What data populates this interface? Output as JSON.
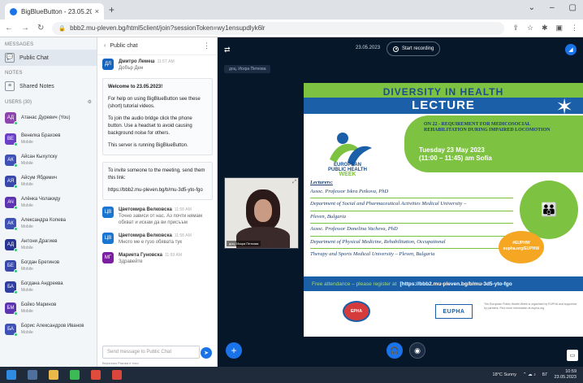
{
  "browser": {
    "tab_title": "BigBlueButton - 23.05.2023",
    "tab_close": "×",
    "new_tab": "+",
    "url": "bbb2.mu-pleven.bg/html5client/join?sessionToken=wy1ensupdlyk6lr",
    "window_controls": [
      "⌄",
      "–",
      "▢"
    ]
  },
  "sidebar": {
    "messages_label": "MESSAGES",
    "public_chat": "Public Chat",
    "notes_label": "NOTES",
    "shared_notes": "Shared Notes",
    "users_label": "USERS (30)",
    "users": [
      {
        "initials": "АД",
        "name": "Атанас Дуревич (You)",
        "sub": "",
        "color": "#8e44ad"
      },
      {
        "initials": "ВЕ",
        "name": "Венелка Брахоев",
        "sub": "Mobile",
        "color": "#6c3fc7"
      },
      {
        "initials": "АК",
        "name": "Айсан Кыхулску",
        "sub": "Mobile",
        "color": "#3f51b5"
      },
      {
        "initials": "АЯ",
        "name": "Айсум Ябдемич",
        "sub": "Mobile",
        "color": "#3949ab"
      },
      {
        "initials": "АЧ",
        "name": "Алёнка Чолакиду",
        "sub": "Mobile",
        "color": "#5e35b1"
      },
      {
        "initials": "АК",
        "name": "Александра Копева",
        "sub": "Mobile",
        "color": "#3f51b5"
      },
      {
        "initials": "АД",
        "name": "Антони Драгиев",
        "sub": "Mobile",
        "color": "#283593"
      },
      {
        "initials": "БЕ",
        "name": "Богдан Брегинов",
        "sub": "Mobile",
        "color": "#3949ab"
      },
      {
        "initials": "БА",
        "name": "Богдана Андреева",
        "sub": "Mobile",
        "color": "#303f9f"
      },
      {
        "initials": "БМ",
        "name": "Бойко Маринов",
        "sub": "Mobile",
        "color": "#5e35b1"
      },
      {
        "initials": "БА",
        "name": "Борис Александров Иванов",
        "sub": "Mobile",
        "color": "#3f51b5"
      }
    ]
  },
  "chat": {
    "back_label": "Public chat",
    "menu_icon": "⋮",
    "messages": [
      {
        "initials": "ДЛ",
        "name": "Дмитро Лемеш",
        "time": "11:57 AM",
        "text": "Добър Ден",
        "color": "#1565c0"
      }
    ],
    "welcome": "Welcome to 23.05.2023!",
    "help_text": "For help on using BigBlueButton see these (short) tutorial videos.",
    "audio_text": "To join the audio bridge click the phone button. Use a headset to avoid causing background noise for others.",
    "server_text": "This server is running BigBlueButton.",
    "invite_text": "To invite someone to the meeting, send them this link:",
    "invite_link": "https://bbb2.mu-pleven.bg/b/mu-3d5-yto-fgo",
    "later_messages": [
      {
        "initials": "ЦВ",
        "name": "Цветомира Велковска",
        "time": "11:58 AM",
        "text": "Точно зависи от нас. Аз почти нямам обхват и искам да ви присъъм",
        "color": "#1976d2"
      },
      {
        "initials": "ЦВ",
        "name": "Цветомира Велковска",
        "time": "11:58 AM",
        "text": "Много ме е гузо обявата тук",
        "color": "#1976d2"
      },
      {
        "initials": "МГ",
        "name": "Мариета Гуновска",
        "time": "11:59 AM",
        "text": "Здравейте",
        "color": "#7b1fa2"
      }
    ],
    "input_placeholder": "Send message to Public Chat",
    "send_icon": "➤",
    "typing_text": "Вероника Ракова е тихо"
  },
  "presentation": {
    "date": "23.05.2023",
    "recording_label": "Start recording",
    "presenter_name": "доц. Искра Петкова",
    "webcam_label": "доц. Искра Петкова",
    "slide": {
      "title1": "DIVERSITY IN HEALTH",
      "title2": "LECTURE",
      "topic": "ON 22 - REQUIREMENT FOR MEDICOSOCIAL REHABILITATION DURING IMPAIRED LOCOMOTION",
      "date_line": "Tuesday 23 May 2023",
      "time_line": "(11:00 – 11:45) am Sofia",
      "eph_line1": "EUROPEAN",
      "eph_line2": "PUBLIC HEALTH",
      "eph_line3": "WEEK",
      "lecturers_heading": "Lecturers:",
      "lecturers": [
        "Assoc. Professor Iskra Petkova, PhD",
        "Department of Social and Pharmaceutical Activities Medical University –",
        "Pleven, Bulgaria",
        "Assoc. Professor Donelina Vacheva, PhD",
        "Department of Physical Medicine, Rehabilitation, Occupational",
        "Therapy and Sports Medical University – Pleven, Bulgaria"
      ],
      "hashtag": "#EUPHW eupha.org/EUPHW",
      "free_attendance": "Free attendance – please register at",
      "register_url": "[https://bbb2.mu-pleven.bg/b/mu-3d5-yto-fgo",
      "logo_epha": "EPHA",
      "logo_eupha": "EUPHA",
      "logo_note": "The European Public Health Week is organised by EUPHA and supported by partners. Find more information at eupha.org"
    }
  },
  "taskbar": {
    "weather": "18°C Sunny",
    "time": "10:59",
    "date": "23.05.2023",
    "lang": "БГ"
  }
}
